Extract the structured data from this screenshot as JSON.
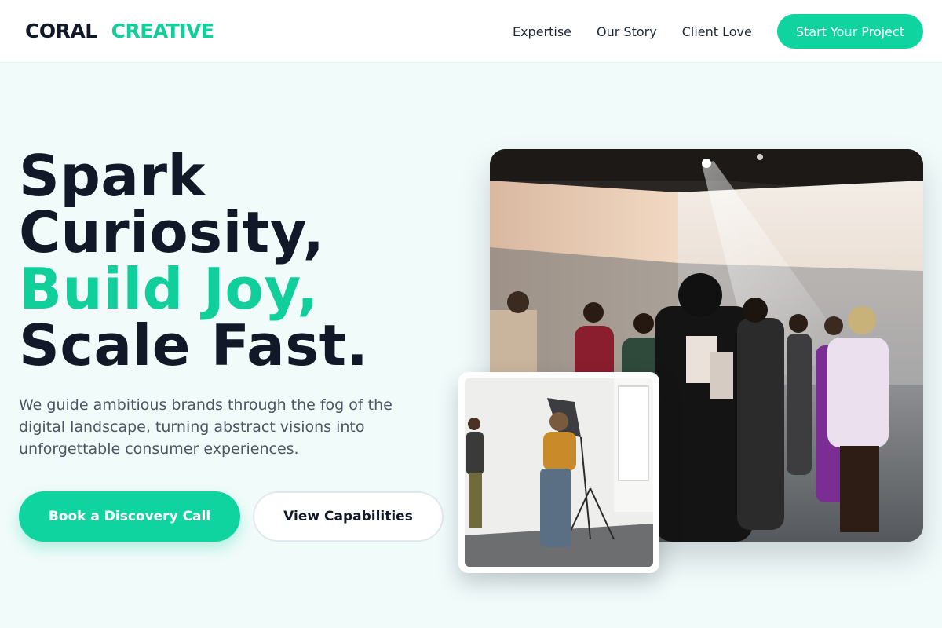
{
  "brand": {
    "word1": "CORAL",
    "word2": "CREATIVE"
  },
  "nav": {
    "links": [
      "Expertise",
      "Our Story",
      "Client Love"
    ],
    "cta": "Start Your Project"
  },
  "hero": {
    "title_line1": "Spark",
    "title_line2": "Curiosity,",
    "title_line3": "Build Joy,",
    "title_line4": "Scale Fast.",
    "description": "We guide ambitious brands through the fog of the digital landscape, turning abstract visions into unforgettable consumer experiences.",
    "primary_button": "Book a Discovery Call",
    "secondary_button": "View Capabilities"
  },
  "colors": {
    "accent": "#10cf9a",
    "heading": "#111827",
    "background": "#f1fbfa"
  }
}
